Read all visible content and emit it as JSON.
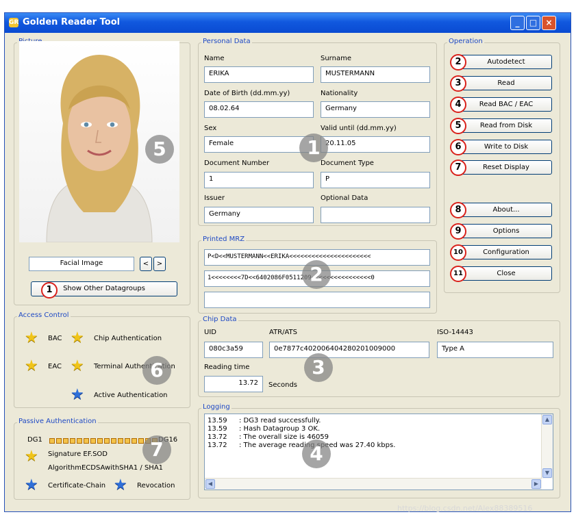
{
  "window": {
    "title": "Golden Reader Tool",
    "icon_text": "GR",
    "minimize": "_",
    "maximize": "□",
    "close": "×"
  },
  "picture": {
    "group_label": "Picture",
    "image_label": "Facial Image",
    "prev": "<",
    "next": ">",
    "show_other_button": "Show Other Datagroups"
  },
  "personal": {
    "group_label": "Personal Data",
    "name_label": "Name",
    "name": "ERIKA",
    "surname_label": "Surname",
    "surname": "MUSTERMANN",
    "dob_label": "Date of Birth (dd.mm.yy)",
    "dob": "08.02.64",
    "nationality_label": "Nationality",
    "nationality": "Germany",
    "sex_label": "Sex",
    "sex": "Female",
    "valid_label": "Valid until (dd.mm.yy)",
    "valid": "20.11.05",
    "docnum_label": "Document Number",
    "docnum": "1",
    "doctype_label": "Document Type",
    "doctype": "P",
    "issuer_label": "Issuer",
    "issuer": "Germany",
    "optional_label": "Optional Data",
    "optional": ""
  },
  "mrz": {
    "group_label": "Printed MRZ",
    "line1": "P<D<<MUSTERMANN<<ERIKA<<<<<<<<<<<<<<<<<<<<<<",
    "line2": "1<<<<<<<<7D<<6402086F0511209<<<<<<<<<<<<<<<<0",
    "line3": ""
  },
  "operation": {
    "group_label": "Operation",
    "buttons": [
      "Autodetect",
      "Read",
      "Read BAC / EAC",
      "Read from Disk",
      "Write to Disk",
      "Reset Display",
      "About...",
      "Options",
      "Configuration",
      "Close"
    ],
    "numbers": [
      "2",
      "3",
      "4",
      "5",
      "6",
      "7",
      "8",
      "9",
      "10",
      "11"
    ]
  },
  "access": {
    "group_label": "Access Control",
    "bac": "BAC",
    "chip_auth": "Chip Authentication",
    "eac": "EAC",
    "terminal_auth": "Terminal Authentication",
    "active_auth": "Active Authentication"
  },
  "chip": {
    "group_label": "Chip Data",
    "uid_label": "UID",
    "uid": "080c3a59",
    "atr_label": "ATR/ATS",
    "atr": "0e7877c402006404280201009000",
    "iso_label": "ISO-14443",
    "iso": "Type A",
    "reading_label": "Reading time",
    "reading": "13.72",
    "seconds": "Seconds"
  },
  "passive": {
    "group_label": "Passive Authentication",
    "dg_start": "DG1",
    "dg_end": "DG16",
    "dg_count": 16,
    "signature": "Signature EF.SOD",
    "algorithm": "AlgorithmECDSAwithSHA1 / SHA1",
    "chain": "Certificate-Chain",
    "revocation": "Revocation"
  },
  "logging": {
    "group_label": "Logging",
    "lines": [
      {
        "time": "13.59",
        "msg": ": DG3 read successfully."
      },
      {
        "time": "13.59",
        "msg": ": Hash Datagroup 3 OK."
      },
      {
        "time": "13.72",
        "msg": ": The overall size is 46059"
      },
      {
        "time": "13.72",
        "msg": ": The average reading speed was 27.40 kbps."
      }
    ],
    "scroll_up": "▲",
    "scroll_down": "▼",
    "scroll_left": "◀",
    "scroll_right": "▶"
  },
  "callouts": {
    "photo": "5",
    "personal": "1",
    "mrz": "2",
    "chip": "3",
    "logging": "4",
    "access": "6",
    "passive": "7",
    "show_other": "1"
  },
  "colors": {
    "accent": "#1d48c4",
    "callout_ring": "#d9201a",
    "titlebar": "#0a4bd2",
    "star_gold": "#f0c419",
    "star_blue": "#2f6fd8"
  },
  "watermark": "https://blog.csdn.net/Alex88389516"
}
